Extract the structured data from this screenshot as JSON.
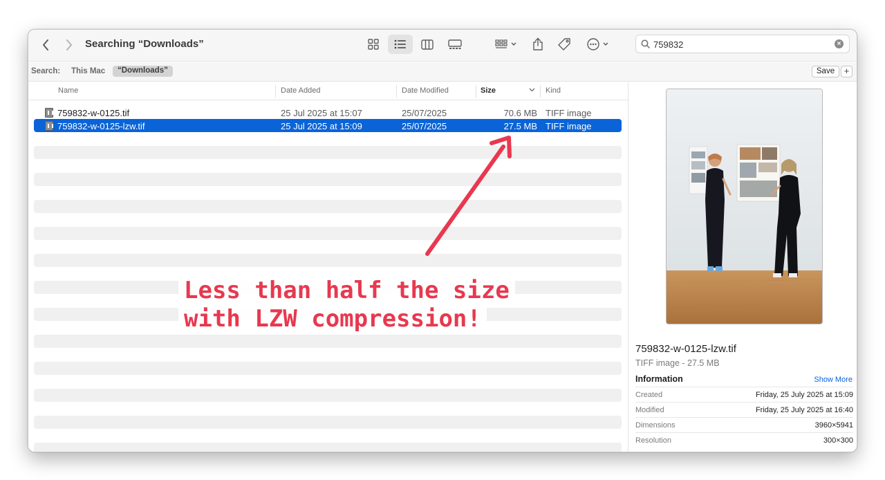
{
  "toolbar": {
    "title": "Searching “Downloads”",
    "search_value": "759832"
  },
  "scope_bar": {
    "label": "Search:",
    "this_mac": "This Mac",
    "downloads": "“Downloads”",
    "save": "Save",
    "add": "+"
  },
  "columns": {
    "name": "Name",
    "date_added": "Date Added",
    "date_modified": "Date Modified",
    "size": "Size",
    "kind": "Kind"
  },
  "files": [
    {
      "name": "759832-w-0125.tif",
      "date_added": "25 Jul 2025 at 15:07",
      "date_modified": "25/07/2025",
      "size": "70.6 MB",
      "kind": "TIFF image",
      "selected": false
    },
    {
      "name": "759832-w-0125-lzw.tif",
      "date_added": "25 Jul 2025 at 15:09",
      "date_modified": "25/07/2025",
      "size": "27.5 MB",
      "kind": "TIFF image",
      "selected": true
    }
  ],
  "preview": {
    "file_name": "759832-w-0125-lzw.tif",
    "subtitle": "TIFF image - 27.5 MB",
    "info_heading": "Information",
    "show_more": "Show More",
    "info": [
      {
        "key": "Created",
        "value": "Friday, 25 July 2025 at 15:09"
      },
      {
        "key": "Modified",
        "value": "Friday, 25 July 2025 at 16:40"
      },
      {
        "key": "Dimensions",
        "value": "3960×5941"
      },
      {
        "key": "Resolution",
        "value": "300×300"
      }
    ]
  },
  "annotation": {
    "line1": "Less than half the size",
    "line2": "with LZW compression!",
    "color": "#e8384f"
  },
  "colors": {
    "selection": "#0a64d8",
    "link": "#0a64d8"
  },
  "icons": [
    "chevron-left-icon",
    "chevron-right-icon",
    "icon-view-icon",
    "list-view-icon",
    "column-view-icon",
    "gallery-view-icon",
    "group-icon",
    "share-icon",
    "tag-icon",
    "more-icon",
    "search-icon",
    "clear-icon",
    "file-icon"
  ]
}
